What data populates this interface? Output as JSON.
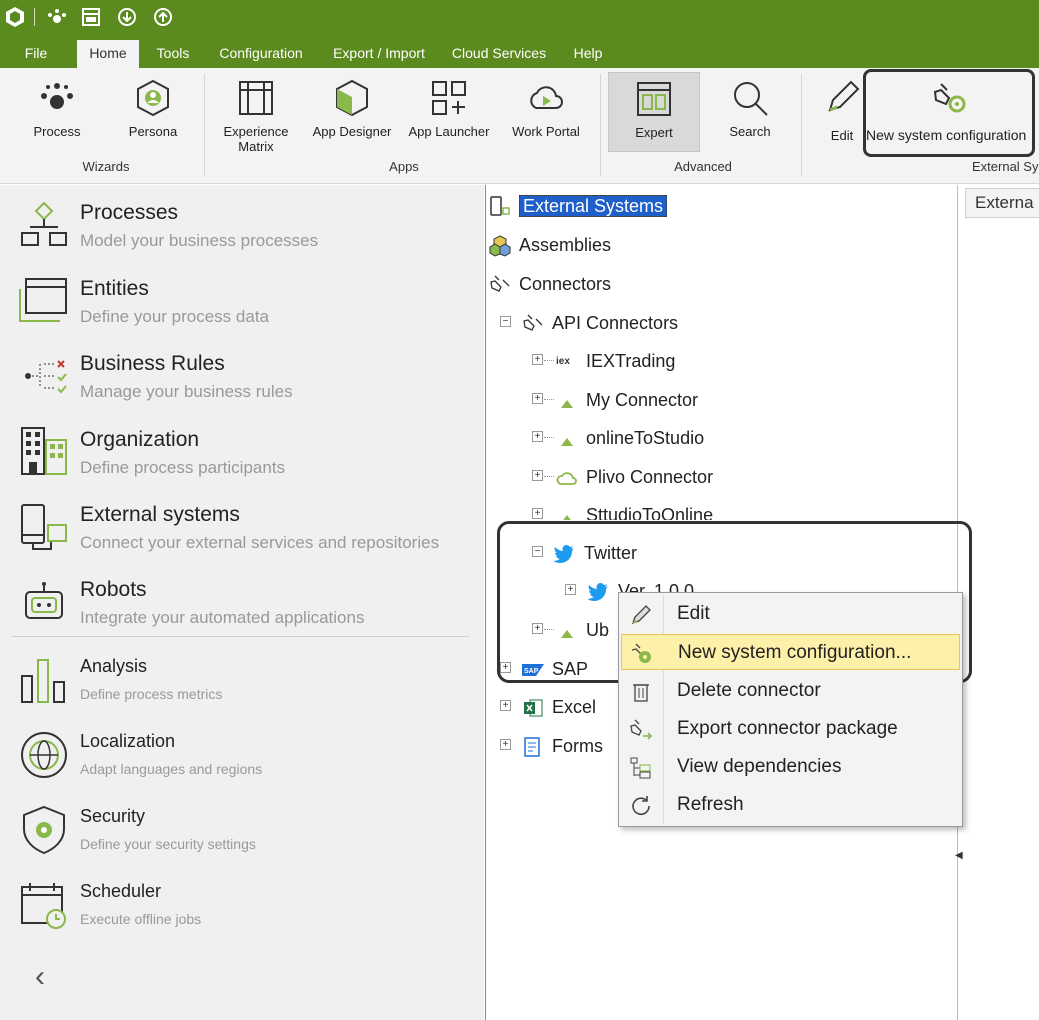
{
  "menu": {
    "tabs": [
      "File",
      "Home",
      "Tools",
      "Configuration",
      "Export / Import",
      "Cloud Services",
      "Help"
    ],
    "active": "Home"
  },
  "ribbon": {
    "wizards": {
      "label": "Wizards",
      "process": "Process",
      "persona": "Persona"
    },
    "apps": {
      "label": "Apps",
      "experience_matrix": "Experience Matrix",
      "app_designer": "App Designer",
      "app_launcher": "App Launcher",
      "work_portal": "Work Portal"
    },
    "advanced": {
      "label": "Advanced",
      "expert": "Expert",
      "search": "Search"
    },
    "external": {
      "label": "External Sy",
      "edit": "Edit",
      "new_system_configuration": "New system configuration"
    }
  },
  "left_nav": [
    {
      "title": "Processes",
      "desc": "Model your business processes"
    },
    {
      "title": "Entities",
      "desc": "Define your process data"
    },
    {
      "title": "Business Rules",
      "desc": "Manage your business rules"
    },
    {
      "title": "Organization",
      "desc": "Define process participants"
    },
    {
      "title": "External systems",
      "desc": "Connect your external services and repositories"
    },
    {
      "title": "Robots",
      "desc": "Integrate your automated applications"
    },
    {
      "title": "Analysis",
      "desc": "Define process metrics"
    },
    {
      "title": "Localization",
      "desc": "Adapt languages and regions"
    },
    {
      "title": "Security",
      "desc": "Define your security settings"
    },
    {
      "title": "Scheduler",
      "desc": "Execute offline jobs"
    }
  ],
  "collapse_glyph": "‹",
  "tree": {
    "external_systems": "External Systems",
    "assemblies": "Assemblies",
    "connectors": "Connectors",
    "api_connectors": "API Connectors",
    "iextrading": "IEXTrading",
    "iex_badge": "iex",
    "my_connector": "My Connector",
    "online_to_studio": "onlineToStudio",
    "plivo_connector": "Plivo Connector",
    "studio_to_online": "SttudioToOnline",
    "twitter": "Twitter",
    "version": "Ver. 1.0.0",
    "ub": "Ub",
    "sap": "SAP",
    "excel": "Excel",
    "forms": "Forms"
  },
  "right_tab": "Externa",
  "context_menu": [
    {
      "label": "Edit",
      "icon": "pencil-icon"
    },
    {
      "label": "New system configuration...",
      "icon": "gear-plug-icon",
      "highlighted": true
    },
    {
      "label": "Delete connector",
      "icon": "trash-icon"
    },
    {
      "label": "Export connector package",
      "icon": "export-icon"
    },
    {
      "label": "View dependencies",
      "icon": "dependencies-icon"
    },
    {
      "label": "Refresh",
      "icon": "refresh-icon"
    }
  ],
  "colors": {
    "brand_green": "#5b8a1f",
    "selection_blue": "#1e5fc9",
    "highlight_yellow": "#fdf0a8",
    "icon_green": "#8ab84a",
    "twitter_blue": "#1d9bf0"
  }
}
